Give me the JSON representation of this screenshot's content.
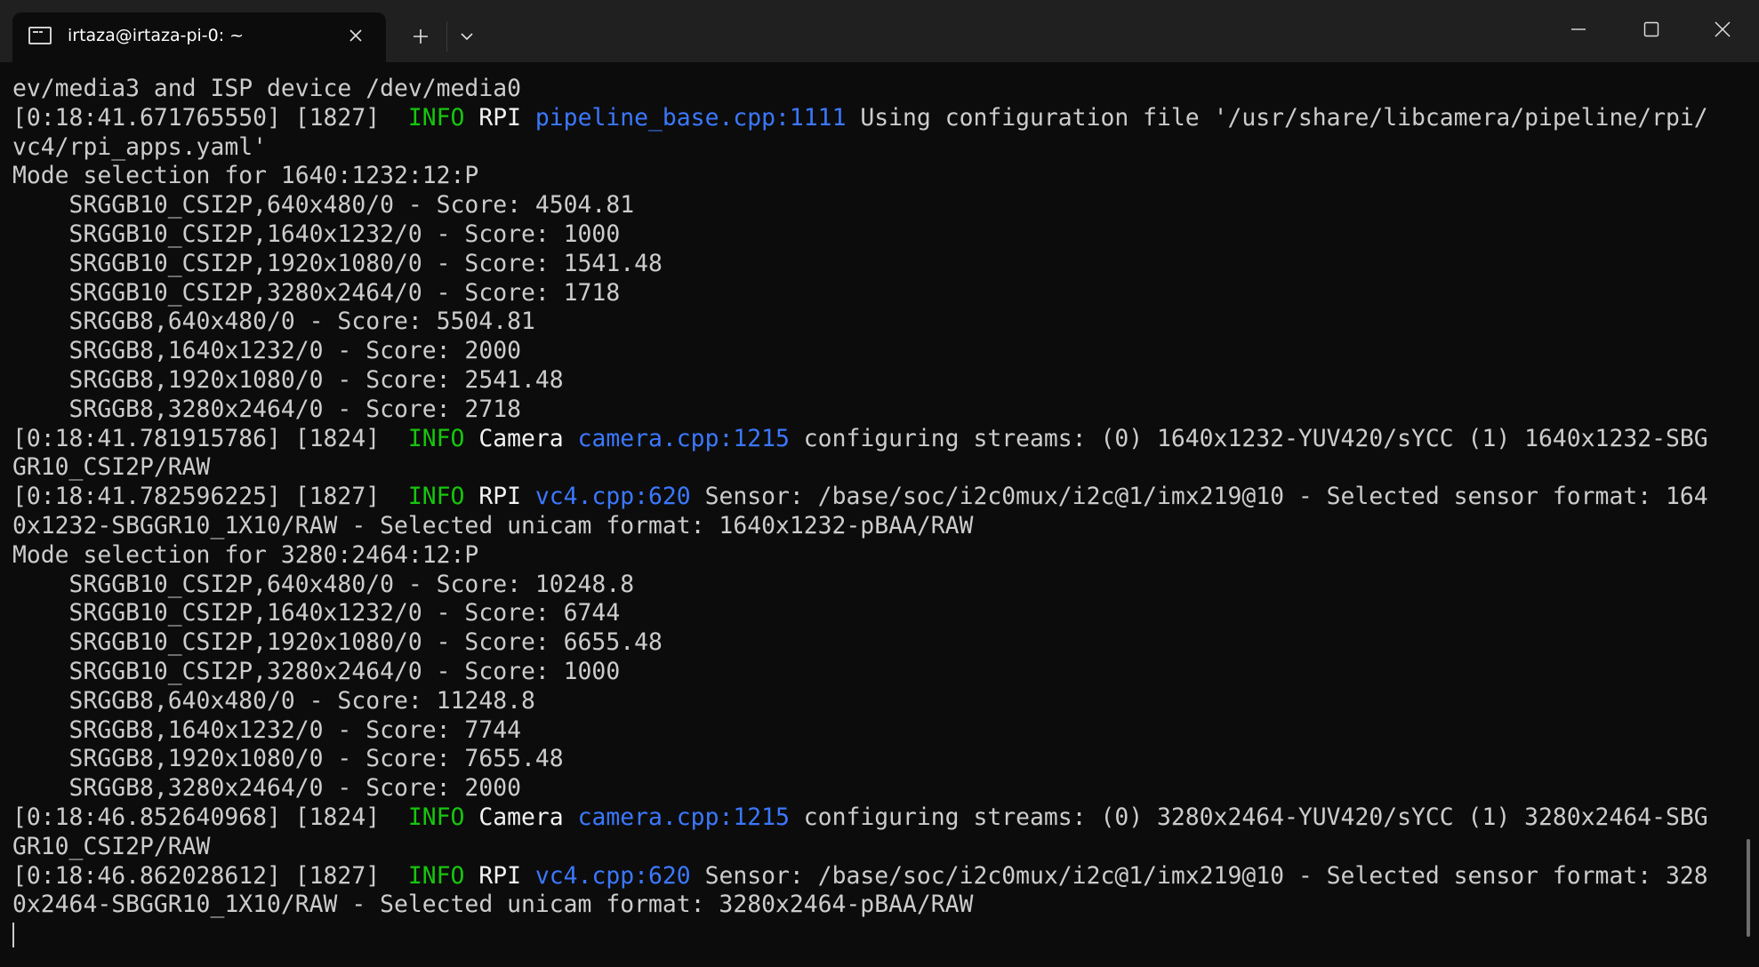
{
  "window": {
    "tab_title": "irtaza@irtaza-pi-0: ~",
    "icons": {
      "tab_icon": "terminal-icon",
      "tab_close": "close-icon",
      "new_tab": "plus-icon",
      "dropdown": "chevron-down-icon",
      "minimize": "minimize-icon",
      "maximize": "maximize-icon",
      "close": "close-icon"
    }
  },
  "colors": {
    "background": "#0c0c0c",
    "titlebar": "#202020",
    "text": "#cccccc",
    "info": "#16c60c",
    "link": "#3b78ff"
  },
  "terminal": {
    "lines": [
      {
        "kind": "plain",
        "text": "ev/media3 and ISP device /dev/media0"
      },
      {
        "kind": "log",
        "prefix": "[0:18:41.671765550] [1827]  ",
        "level": "INFO",
        "category": "RPI",
        "source": "pipeline_base.cpp:1111",
        "message": " Using configuration file '/usr/share/libcamera/pipeline/rpi/"
      },
      {
        "kind": "plain",
        "text": "vc4/rpi_apps.yaml'"
      },
      {
        "kind": "plain",
        "text": "Mode selection for 1640:1232:12:P"
      },
      {
        "kind": "plain",
        "text": "    SRGGB10_CSI2P,640x480/0 - Score: 4504.81"
      },
      {
        "kind": "plain",
        "text": "    SRGGB10_CSI2P,1640x1232/0 - Score: 1000"
      },
      {
        "kind": "plain",
        "text": "    SRGGB10_CSI2P,1920x1080/0 - Score: 1541.48"
      },
      {
        "kind": "plain",
        "text": "    SRGGB10_CSI2P,3280x2464/0 - Score: 1718"
      },
      {
        "kind": "plain",
        "text": "    SRGGB8,640x480/0 - Score: 5504.81"
      },
      {
        "kind": "plain",
        "text": "    SRGGB8,1640x1232/0 - Score: 2000"
      },
      {
        "kind": "plain",
        "text": "    SRGGB8,1920x1080/0 - Score: 2541.48"
      },
      {
        "kind": "plain",
        "text": "    SRGGB8,3280x2464/0 - Score: 2718"
      },
      {
        "kind": "log",
        "prefix": "[0:18:41.781915786] [1824]  ",
        "level": "INFO",
        "category": "Camera",
        "source": "camera.cpp:1215",
        "message": " configuring streams: (0) 1640x1232-YUV420/sYCC (1) 1640x1232-SBG"
      },
      {
        "kind": "plain",
        "text": "GR10_CSI2P/RAW"
      },
      {
        "kind": "log",
        "prefix": "[0:18:41.782596225] [1827]  ",
        "level": "INFO",
        "category": "RPI",
        "source": "vc4.cpp:620",
        "message": " Sensor: /base/soc/i2c0mux/i2c@1/imx219@10 - Selected sensor format: 164"
      },
      {
        "kind": "plain",
        "text": "0x1232-SBGGR10_1X10/RAW - Selected unicam format: 1640x1232-pBAA/RAW"
      },
      {
        "kind": "plain",
        "text": "Mode selection for 3280:2464:12:P"
      },
      {
        "kind": "plain",
        "text": "    SRGGB10_CSI2P,640x480/0 - Score: 10248.8"
      },
      {
        "kind": "plain",
        "text": "    SRGGB10_CSI2P,1640x1232/0 - Score: 6744"
      },
      {
        "kind": "plain",
        "text": "    SRGGB10_CSI2P,1920x1080/0 - Score: 6655.48"
      },
      {
        "kind": "plain",
        "text": "    SRGGB10_CSI2P,3280x2464/0 - Score: 1000"
      },
      {
        "kind": "plain",
        "text": "    SRGGB8,640x480/0 - Score: 11248.8"
      },
      {
        "kind": "plain",
        "text": "    SRGGB8,1640x1232/0 - Score: 7744"
      },
      {
        "kind": "plain",
        "text": "    SRGGB8,1920x1080/0 - Score: 7655.48"
      },
      {
        "kind": "plain",
        "text": "    SRGGB8,3280x2464/0 - Score: 2000"
      },
      {
        "kind": "log",
        "prefix": "[0:18:46.852640968] [1824]  ",
        "level": "INFO",
        "category": "Camera",
        "source": "camera.cpp:1215",
        "message": " configuring streams: (0) 3280x2464-YUV420/sYCC (1) 3280x2464-SBG"
      },
      {
        "kind": "plain",
        "text": "GR10_CSI2P/RAW"
      },
      {
        "kind": "log",
        "prefix": "[0:18:46.862028612] [1827]  ",
        "level": "INFO",
        "category": "RPI",
        "source": "vc4.cpp:620",
        "message": " Sensor: /base/soc/i2c0mux/i2c@1/imx219@10 - Selected sensor format: 328"
      },
      {
        "kind": "plain",
        "text": "0x2464-SBGGR10_1X10/RAW - Selected unicam format: 3280x2464-pBAA/RAW"
      }
    ]
  }
}
